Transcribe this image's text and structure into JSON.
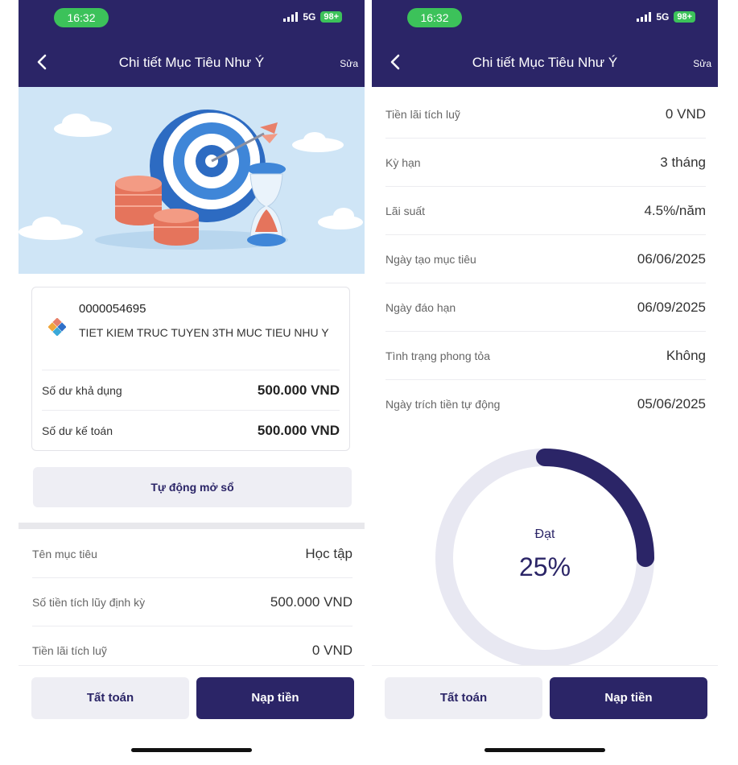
{
  "status": {
    "time": "16:32",
    "network": "5G",
    "battery": "98+"
  },
  "nav": {
    "title": "Chi tiết Mục Tiêu Như Ý",
    "edit_label": "Sửa"
  },
  "account": {
    "number": "0000054695",
    "name": "TIET KIEM TRUC TUYEN 3TH MUC TIEU NHU Y",
    "available_balance_label": "Số dư khả dụng",
    "available_balance_value": "500.000 VND",
    "accounting_balance_label": "Số dư kế toán",
    "accounting_balance_value": "500.000 VND"
  },
  "auto_open_label": "Tự động mở sổ",
  "left_details": [
    {
      "label": "Tên mục tiêu",
      "value": "Học tập"
    },
    {
      "label": "Số tiền tích lũy định kỳ",
      "value": "500.000 VND"
    },
    {
      "label": "Tiền lãi tích luỹ",
      "value": "0 VND"
    }
  ],
  "right_details": [
    {
      "label": "Tiền lãi tích luỹ",
      "value": "0 VND"
    },
    {
      "label": "Kỳ hạn",
      "value": "3 tháng"
    },
    {
      "label": "Lãi suất",
      "value": "4.5%/năm"
    },
    {
      "label": "Ngày tạo mục tiêu",
      "value": "06/06/2025"
    },
    {
      "label": "Ngày đáo hạn",
      "value": "06/09/2025"
    },
    {
      "label": "Tình trạng phong tỏa",
      "value": "Không"
    },
    {
      "label": "Ngày trích tiền tự động",
      "value": "05/06/2025"
    }
  ],
  "progress": {
    "label": "Đạt",
    "percent_text": "25%",
    "fraction": 0.25
  },
  "actions": {
    "settle_label": "Tất toán",
    "deposit_label": "Nạp tiền"
  },
  "colors": {
    "primary": "#2b2567",
    "status_green": "#3cc25a",
    "hero_bg": "#cfe5f6",
    "target_blue": "#2f6fc8",
    "coin": "#e8806a"
  },
  "icons": [
    "back-arrow-icon",
    "signal-icon",
    "battery-icon",
    "bank-logo-icon",
    "target-illustration",
    "coins-illustration",
    "hourglass-illustration"
  ]
}
